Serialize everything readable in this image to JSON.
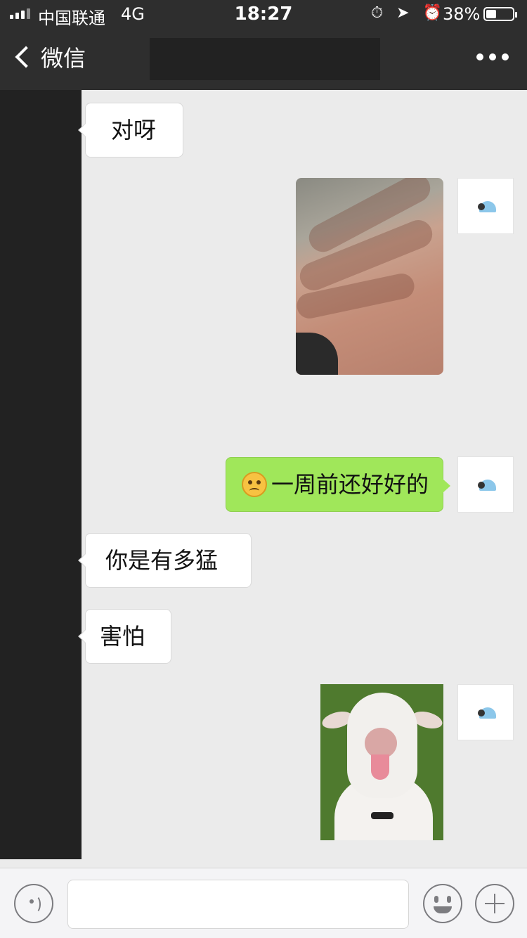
{
  "status_bar": {
    "carrier": "中国联通",
    "network": "4G",
    "time": "18:27",
    "status_icons": "⏱ ➤ ⏰",
    "battery_percent": "38%",
    "battery_level": 0.38
  },
  "nav": {
    "back_label": "微信",
    "chat_title_redacted": true,
    "more_icon": "more-dots-icon"
  },
  "messages": [
    {
      "side": "in",
      "type": "text",
      "text": "对呀"
    },
    {
      "side": "out",
      "type": "image",
      "image": "hand-photo"
    },
    {
      "side": "out",
      "type": "text",
      "emoji": "worried-face-emoji",
      "text": "一周前还好好的"
    },
    {
      "side": "in",
      "type": "text",
      "text": "你是有多猛"
    },
    {
      "side": "in",
      "type": "text",
      "text": "害怕"
    },
    {
      "side": "out",
      "type": "image",
      "image": "goat-sticker"
    }
  ],
  "input_bar": {
    "voice_icon": "voice-icon",
    "text_value": "",
    "emoji_icon": "emoji-icon",
    "plus_icon": "plus-icon"
  },
  "colors": {
    "header_bg": "#2e2e2e",
    "chat_bg": "#ebebeb",
    "outgoing_bubble": "#a0e75a",
    "incoming_bubble": "#ffffff"
  }
}
